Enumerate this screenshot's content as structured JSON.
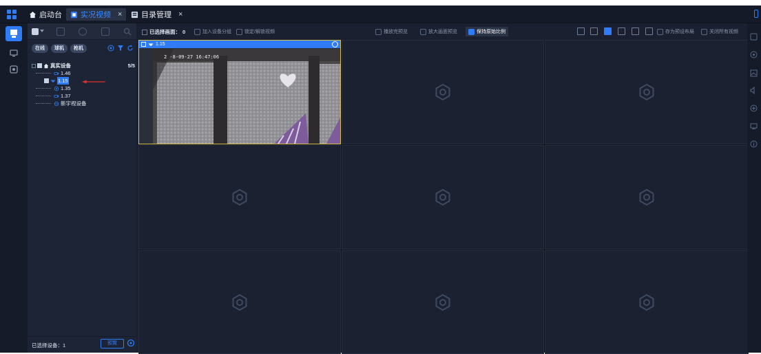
{
  "tabs": [
    {
      "label": "启动台",
      "icon": "home-icon",
      "active": false
    },
    {
      "label": "实况视频",
      "icon": "video-icon",
      "active": true
    },
    {
      "label": "目录管理",
      "icon": "catalog-icon",
      "active": false
    }
  ],
  "tab_close_glyph": "×",
  "filters": [
    "在线",
    "球机",
    "枪机"
  ],
  "tree": {
    "root": {
      "label": "真实设备",
      "count": "5/5"
    },
    "children": [
      {
        "label": "1.46",
        "selected": false
      },
      {
        "label": "1.15",
        "selected": true
      },
      {
        "label": "1.35",
        "selected": false
      },
      {
        "label": "1.37",
        "selected": false
      },
      {
        "label": "新宇视设备",
        "selected": false
      }
    ]
  },
  "panel_bottom": {
    "selected_devices": "已选择设备：1",
    "stop_label": "預覽"
  },
  "toolbar": {
    "selected_screens_label": "已选择画面：",
    "selected_screens_value": "0",
    "add_to_group": "加入设备分组",
    "lock_audio": "锁定/解锁视频",
    "bidirectional": "播放完预览",
    "enlarge": "放大画面预览",
    "keep_ratio": "保持原始比例",
    "save_layout": "存为预设布局",
    "close_all": "关闭所有视频"
  },
  "live_cell": {
    "title": "1.15",
    "osd_timestamp": "2 -8-09-27 16:47:06"
  },
  "colors": {
    "accent": "#2f7cf6",
    "background": "#1b2130",
    "selected_border": "#d8c24c",
    "arrow": "#e0302a"
  }
}
